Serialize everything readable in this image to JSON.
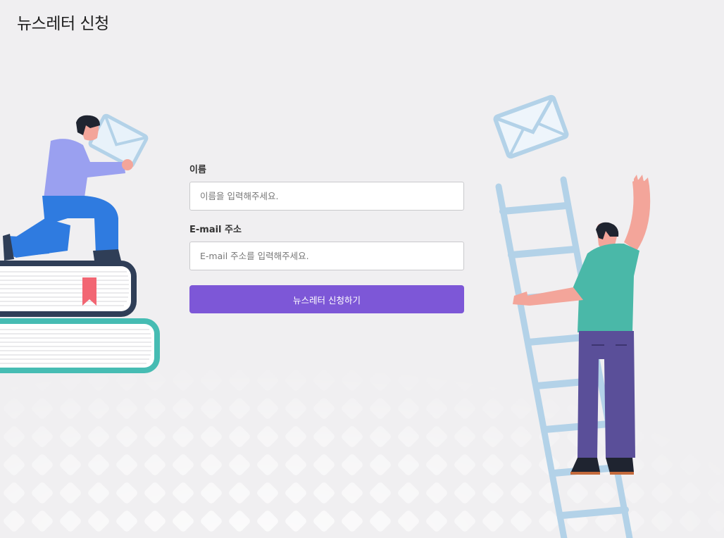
{
  "page": {
    "title": "뉴스레터 신청"
  },
  "form": {
    "name_label": "이름",
    "name_placeholder": "이름을 입력해주세요.",
    "name_value": "",
    "email_label": "E-mail 주소",
    "email_placeholder": "E-mail 주소를 입력해주세요.",
    "email_value": "",
    "submit_label": "뉴스레터 신청하기"
  },
  "colors": {
    "background": "#f0eff1",
    "accent": "#7d57d7",
    "ladder": "#b3d2e8",
    "book_navy": "#2f3e57",
    "book_teal": "#46bcb3",
    "shirt_purple": "#9aa0f0",
    "pants_blue": "#2f7be0",
    "shirt_teal": "#4ab8a8",
    "pants_purple": "#5a4f99",
    "skin": "#f3a59a"
  },
  "icons": [
    "envelope-icon",
    "bookmark-icon"
  ]
}
